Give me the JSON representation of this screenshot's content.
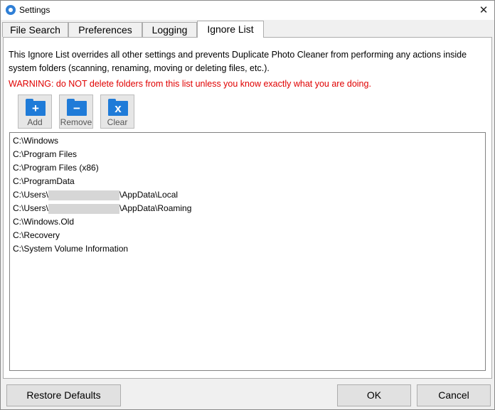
{
  "window": {
    "title": "Settings",
    "close_symbol": "✕"
  },
  "tabs": [
    {
      "label": "File Search"
    },
    {
      "label": "Preferences"
    },
    {
      "label": "Logging"
    },
    {
      "label": "Ignore List"
    }
  ],
  "active_tab": "Ignore List",
  "panel": {
    "description": "This Ignore List overrides all other settings and prevents Duplicate Photo Cleaner from performing any actions inside system folders (scanning, renaming, moving or deleting files, etc.).",
    "warning": "WARNING: do NOT delete folders from this list unless you know exactly what you are doing.",
    "warning_color": "#e00000",
    "toolbar": {
      "add": {
        "label": "Add",
        "icon": "folder-add-icon",
        "symbol": "+"
      },
      "remove": {
        "label": "Remove",
        "icon": "folder-remove-icon",
        "symbol": "−"
      },
      "clear": {
        "label": "Clear",
        "icon": "folder-clear-icon",
        "symbol": "x"
      }
    },
    "ignore_list": {
      "item0": "C:\\Windows",
      "item1": "C:\\Program Files",
      "item2": "C:\\Program Files (x86)",
      "item3": "C:\\ProgramData",
      "item4_prefix": "C:\\Users\\",
      "item4_suffix": "\\AppData\\Local",
      "item5_prefix": "C:\\Users\\",
      "item5_suffix": "\\AppData\\Roaming",
      "item6": "C:\\Windows.Old",
      "item7": "C:\\Recovery",
      "item8": "C:\\System Volume Information"
    }
  },
  "footer": {
    "restore_defaults": "Restore Defaults",
    "ok": "OK",
    "cancel": "Cancel"
  },
  "colors": {
    "folder_icon": "#1f7bd8",
    "accent": "#0078d7"
  }
}
